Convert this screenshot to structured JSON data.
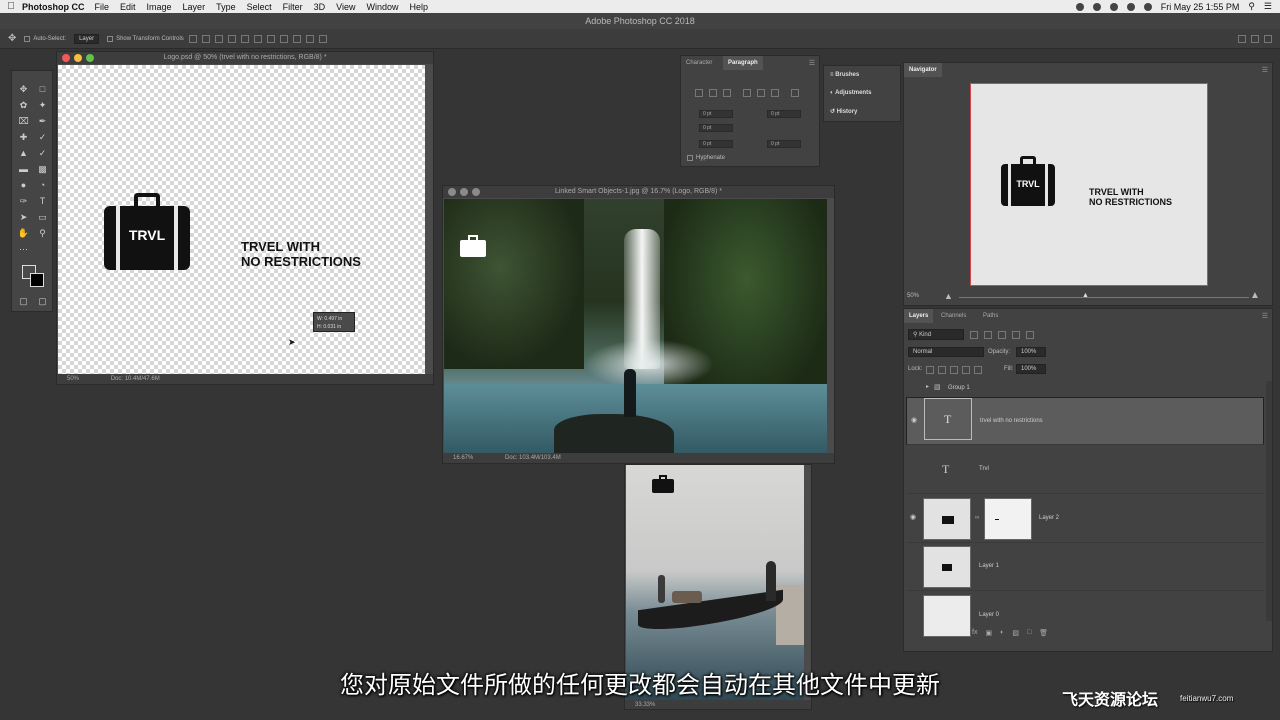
{
  "menubar": {
    "app_name": "Photoshop CC",
    "items": [
      "File",
      "Edit",
      "Image",
      "Layer",
      "Type",
      "Select",
      "Filter",
      "3D",
      "View",
      "Window",
      "Help"
    ],
    "datetime": "Fri May 25  1:55 PM"
  },
  "titlebar": {
    "title": "Adobe Photoshop CC 2018"
  },
  "options": {
    "auto_select": "Auto-Select:",
    "layer_select": "Layer",
    "show_transform": "Show Transform Controls"
  },
  "doc_logo": {
    "title": "Logo.psd @ 50% (trvel with no restrictions, RGB/8) *",
    "zoom": "50%",
    "doc_size": "Doc: 10.4M/47.6M",
    "logo_badge": "TRVL",
    "tagline_1": "TRVEL WITH",
    "tagline_2": "NO RESTRICTIONS",
    "tooltip_w": "W: 0.497 in",
    "tooltip_h": "H: 0.031 in"
  },
  "doc_waterfall": {
    "title": "Linked Smart Objects-1.jpg @ 16.7% (Logo, RGB/8) *",
    "zoom": "16.67%",
    "doc_size": "Doc: 103.4M/103.4M"
  },
  "doc_gondola": {
    "zoom": "33.33%"
  },
  "character_panel": {
    "tab_character": "Character",
    "tab_paragraph": "Paragraph",
    "field_values": [
      "0 pt",
      "0 pt",
      "0 pt",
      "0 pt",
      "0 pt"
    ],
    "hyphenate": "Hyphenate"
  },
  "side_panels": {
    "brushes": "Brushes",
    "adjustments": "Adjustments",
    "history": "History"
  },
  "navigator": {
    "tab": "Navigator",
    "zoom": "50%",
    "badge": "TRVL",
    "tagline_1": "TRVEL WITH",
    "tagline_2": "NO RESTRICTIONS"
  },
  "layers_panel": {
    "tabs": [
      "Layers",
      "Channels",
      "Paths"
    ],
    "kind": "Kind",
    "blend_mode": "Normal",
    "opacity_label": "Opacity:",
    "opacity": "100%",
    "lock_label": "Lock:",
    "fill_label": "Fill:",
    "fill": "100%",
    "group_name": "Group 1",
    "layers": [
      {
        "name": "trvel with no restrictions"
      },
      {
        "name": "Trvl"
      },
      {
        "name": "Layer 2"
      },
      {
        "name": "Layer 1"
      },
      {
        "name": "Layer 0"
      }
    ],
    "text_glyph": "T"
  },
  "subtitle": "您对原始文件所做的任何更改都会自动在其他文件中更新",
  "watermark": {
    "brand": "飞天资源论坛",
    "url": "feitianwu7.com"
  },
  "colors": {
    "app_bg": "#353535",
    "panel": "#424242",
    "selected_layer": "#5c5c5c"
  }
}
